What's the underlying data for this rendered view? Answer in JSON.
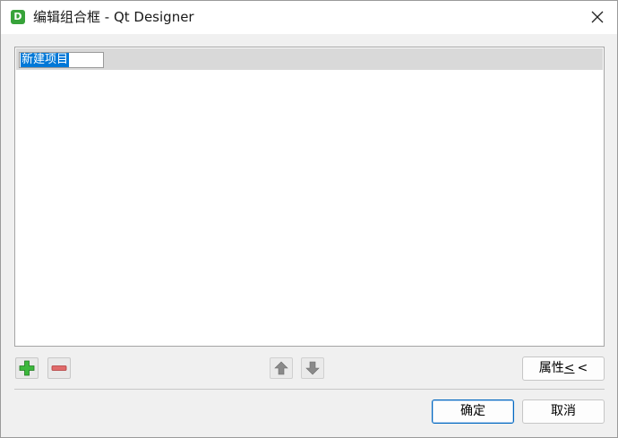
{
  "window": {
    "title": "编辑组合框 - Qt Designer",
    "app_icon_letter": "D"
  },
  "list": {
    "items": [
      {
        "label": "新建项目",
        "editing": true
      }
    ]
  },
  "toolbar": {
    "add_icon": "plus-icon",
    "remove_icon": "minus-icon",
    "move_up_icon": "arrow-up-icon",
    "move_down_icon": "arrow-down-icon",
    "properties_label_prefix": "属性",
    "properties_label_underlined": "<",
    "properties_label_suffix": "<"
  },
  "buttons": {
    "ok_label": "确定",
    "cancel_label": "取消"
  },
  "colors": {
    "accent": "#0078d7",
    "add_green": "#3cb83c",
    "remove_red": "#e06a6a"
  }
}
